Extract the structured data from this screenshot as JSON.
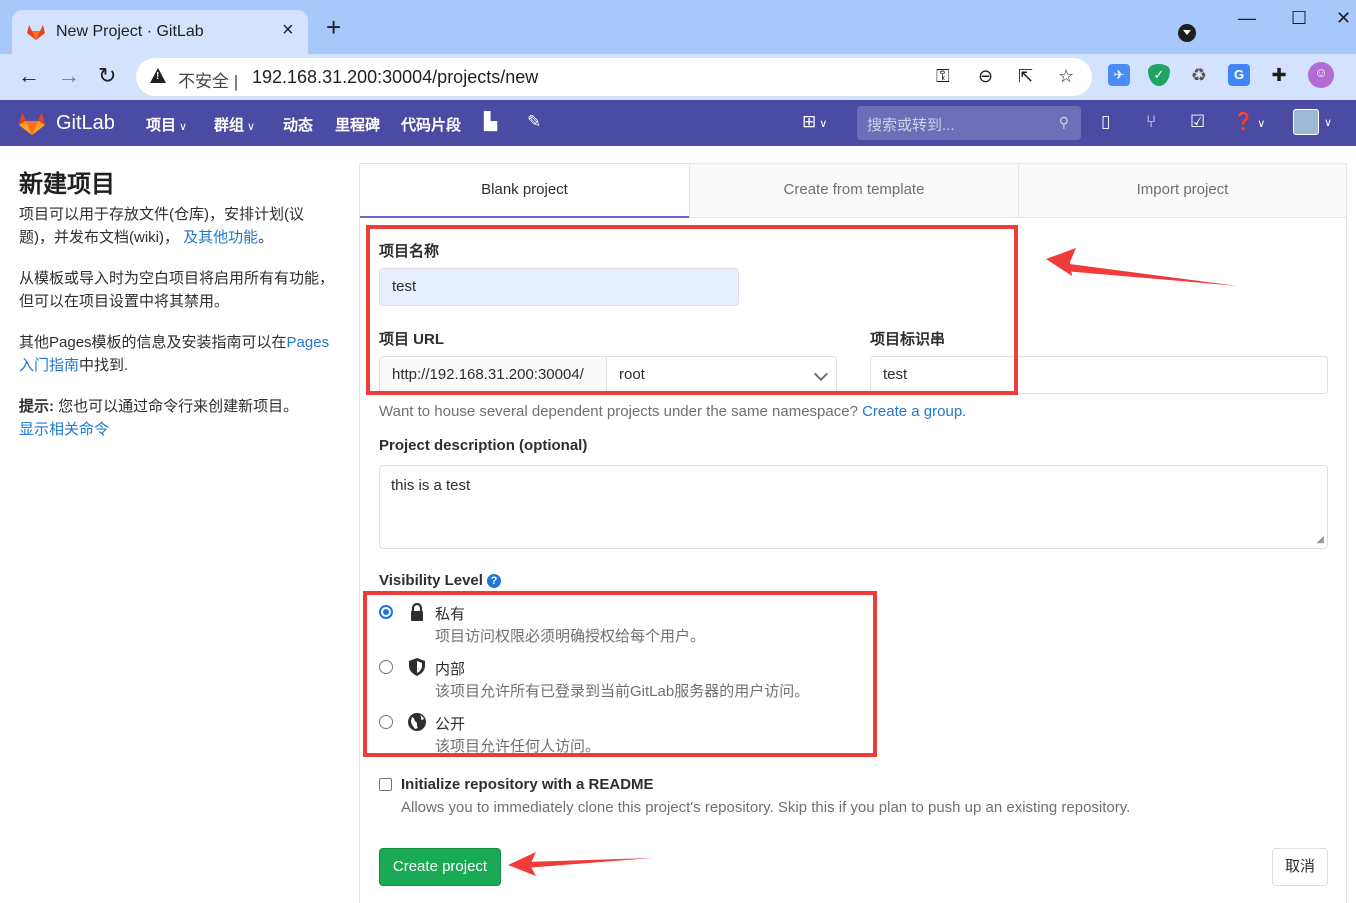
{
  "browser": {
    "tab_title": "New Project · GitLab",
    "tab_close": "×",
    "new_tab": "+",
    "window_controls": [
      "—",
      "☐",
      "✕"
    ],
    "back": "←",
    "forward": "→",
    "reload": "↻",
    "insecure_label": "不安全 |",
    "url": "192.168.31.200:30004/projects/new"
  },
  "gitlab_nav": {
    "brand": "GitLab",
    "menu": [
      {
        "label": "项目",
        "dropdown": true
      },
      {
        "label": "群组",
        "dropdown": true
      },
      {
        "label": "动态",
        "dropdown": false
      },
      {
        "label": "里程碑",
        "dropdown": false
      },
      {
        "label": "代码片段",
        "dropdown": false
      }
    ],
    "search_placeholder": "搜索或转到...",
    "colors": {
      "navbar": "#4b4ba3",
      "search": "#6e6eb8"
    }
  },
  "sidebar": {
    "title": "新建项目",
    "p1_text": "项目可以用于存放文件(仓库)，安排计划(议题)，并发布文档(wiki)，",
    "p1_link": "及其他功能",
    "p1_end": "。",
    "p2_text": "从模板或导入时为空白项目将启用所有有功能，但可以在项目设置中将其禁用。",
    "p3_text": "其他Pages模板的信息及安装指南可以在",
    "p3_link": "Pages 入门指南",
    "p3_end": "中找到.",
    "tip_label": "提示:",
    "tip_text": " 您也可以通过命令行来创建新项目。",
    "tip_link": "显示相关命令"
  },
  "tabs": [
    {
      "label": "Blank project",
      "active": true
    },
    {
      "label": "Create from template",
      "active": false
    },
    {
      "label": "Import project",
      "active": false
    }
  ],
  "form": {
    "name_label": "项目名称",
    "name_value": "test",
    "url_label": "项目 URL",
    "url_prefix": "http://192.168.31.200:30004/",
    "namespace_value": "root",
    "slug_label": "项目标识串",
    "slug_value": "test",
    "group_help": "Want to house several dependent projects under the same namespace?",
    "group_link": "Create a group.",
    "description_label": "Project description (optional)",
    "description_value": "this is a test",
    "visibility_label": "Visibility Level",
    "visibility_options": [
      {
        "title": "私有",
        "desc": "项目访问权限必须明确授权给每个用户。",
        "icon": "lock-icon",
        "checked": true
      },
      {
        "title": "内部",
        "desc": "该项目允许所有已登录到当前GitLab服务器的用户访问。",
        "icon": "shield-icon",
        "checked": false
      },
      {
        "title": "公开",
        "desc": "该项目允许任何人访问。",
        "icon": "globe-icon",
        "checked": false
      }
    ],
    "readme_label": "Initialize repository with a README",
    "readme_desc": "Allows you to immediately clone this project's repository. Skip this if you plan to push up an existing repository.",
    "readme_checked": false,
    "create_button": "Create project",
    "cancel_button": "取消"
  },
  "colors": {
    "annotation_red": "#f03b3b",
    "primary_green": "#1aaa55",
    "link_blue": "#1f78d1"
  }
}
